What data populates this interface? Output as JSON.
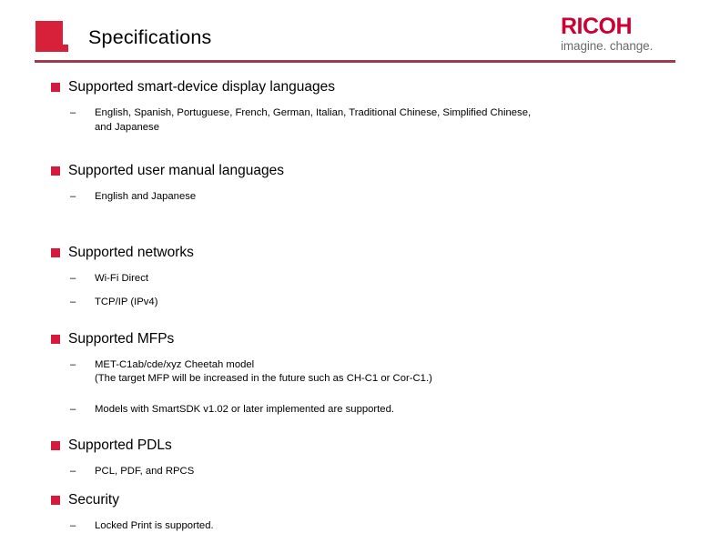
{
  "header": {
    "title": "Specifications",
    "marker_color": "#d7203a",
    "rule_color": "#9e3a4c",
    "logo": {
      "wordmark": "RICOH",
      "tagline": "imagine. change.",
      "wordmark_color": "#cc0033",
      "tagline_color": "#6b6b6b"
    }
  },
  "theme": {
    "bullet_color": "#d6193c",
    "text_color": "#000000",
    "background": "#ffffff"
  },
  "content": {
    "sections": [
      {
        "title": "Supported smart-device display languages",
        "items": [
          {
            "lines": [
              "English, Spanish, Portuguese, French, German, Italian, Traditional Chinese, Simplified Chinese,",
              "and Japanese"
            ]
          }
        ]
      },
      {
        "title": "Supported user manual languages",
        "items": [
          {
            "lines": [
              "English and Japanese"
            ]
          }
        ]
      },
      {
        "title": "Supported networks",
        "items": [
          {
            "lines": [
              "Wi-Fi Direct"
            ]
          },
          {
            "lines": [
              "TCP/IP (IPv4)"
            ]
          }
        ]
      },
      {
        "title": "Supported MFPs",
        "items": [
          {
            "lines": [
              "MET-C1ab/cde/xyz Cheetah model",
              "(The target MFP will be increased in the future such as CH-C1 or Cor-C1.)"
            ]
          },
          {
            "lines": [
              "Models with SmartSDK v1.02 or later implemented are supported."
            ]
          }
        ]
      },
      {
        "title": "Supported PDLs",
        "items": [
          {
            "lines": [
              "PCL, PDF, and RPCS"
            ]
          }
        ]
      },
      {
        "title": "Security",
        "items": [
          {
            "lines": [
              "Locked Print is supported."
            ]
          }
        ]
      }
    ],
    "sub_bullet_glyph": "–"
  }
}
